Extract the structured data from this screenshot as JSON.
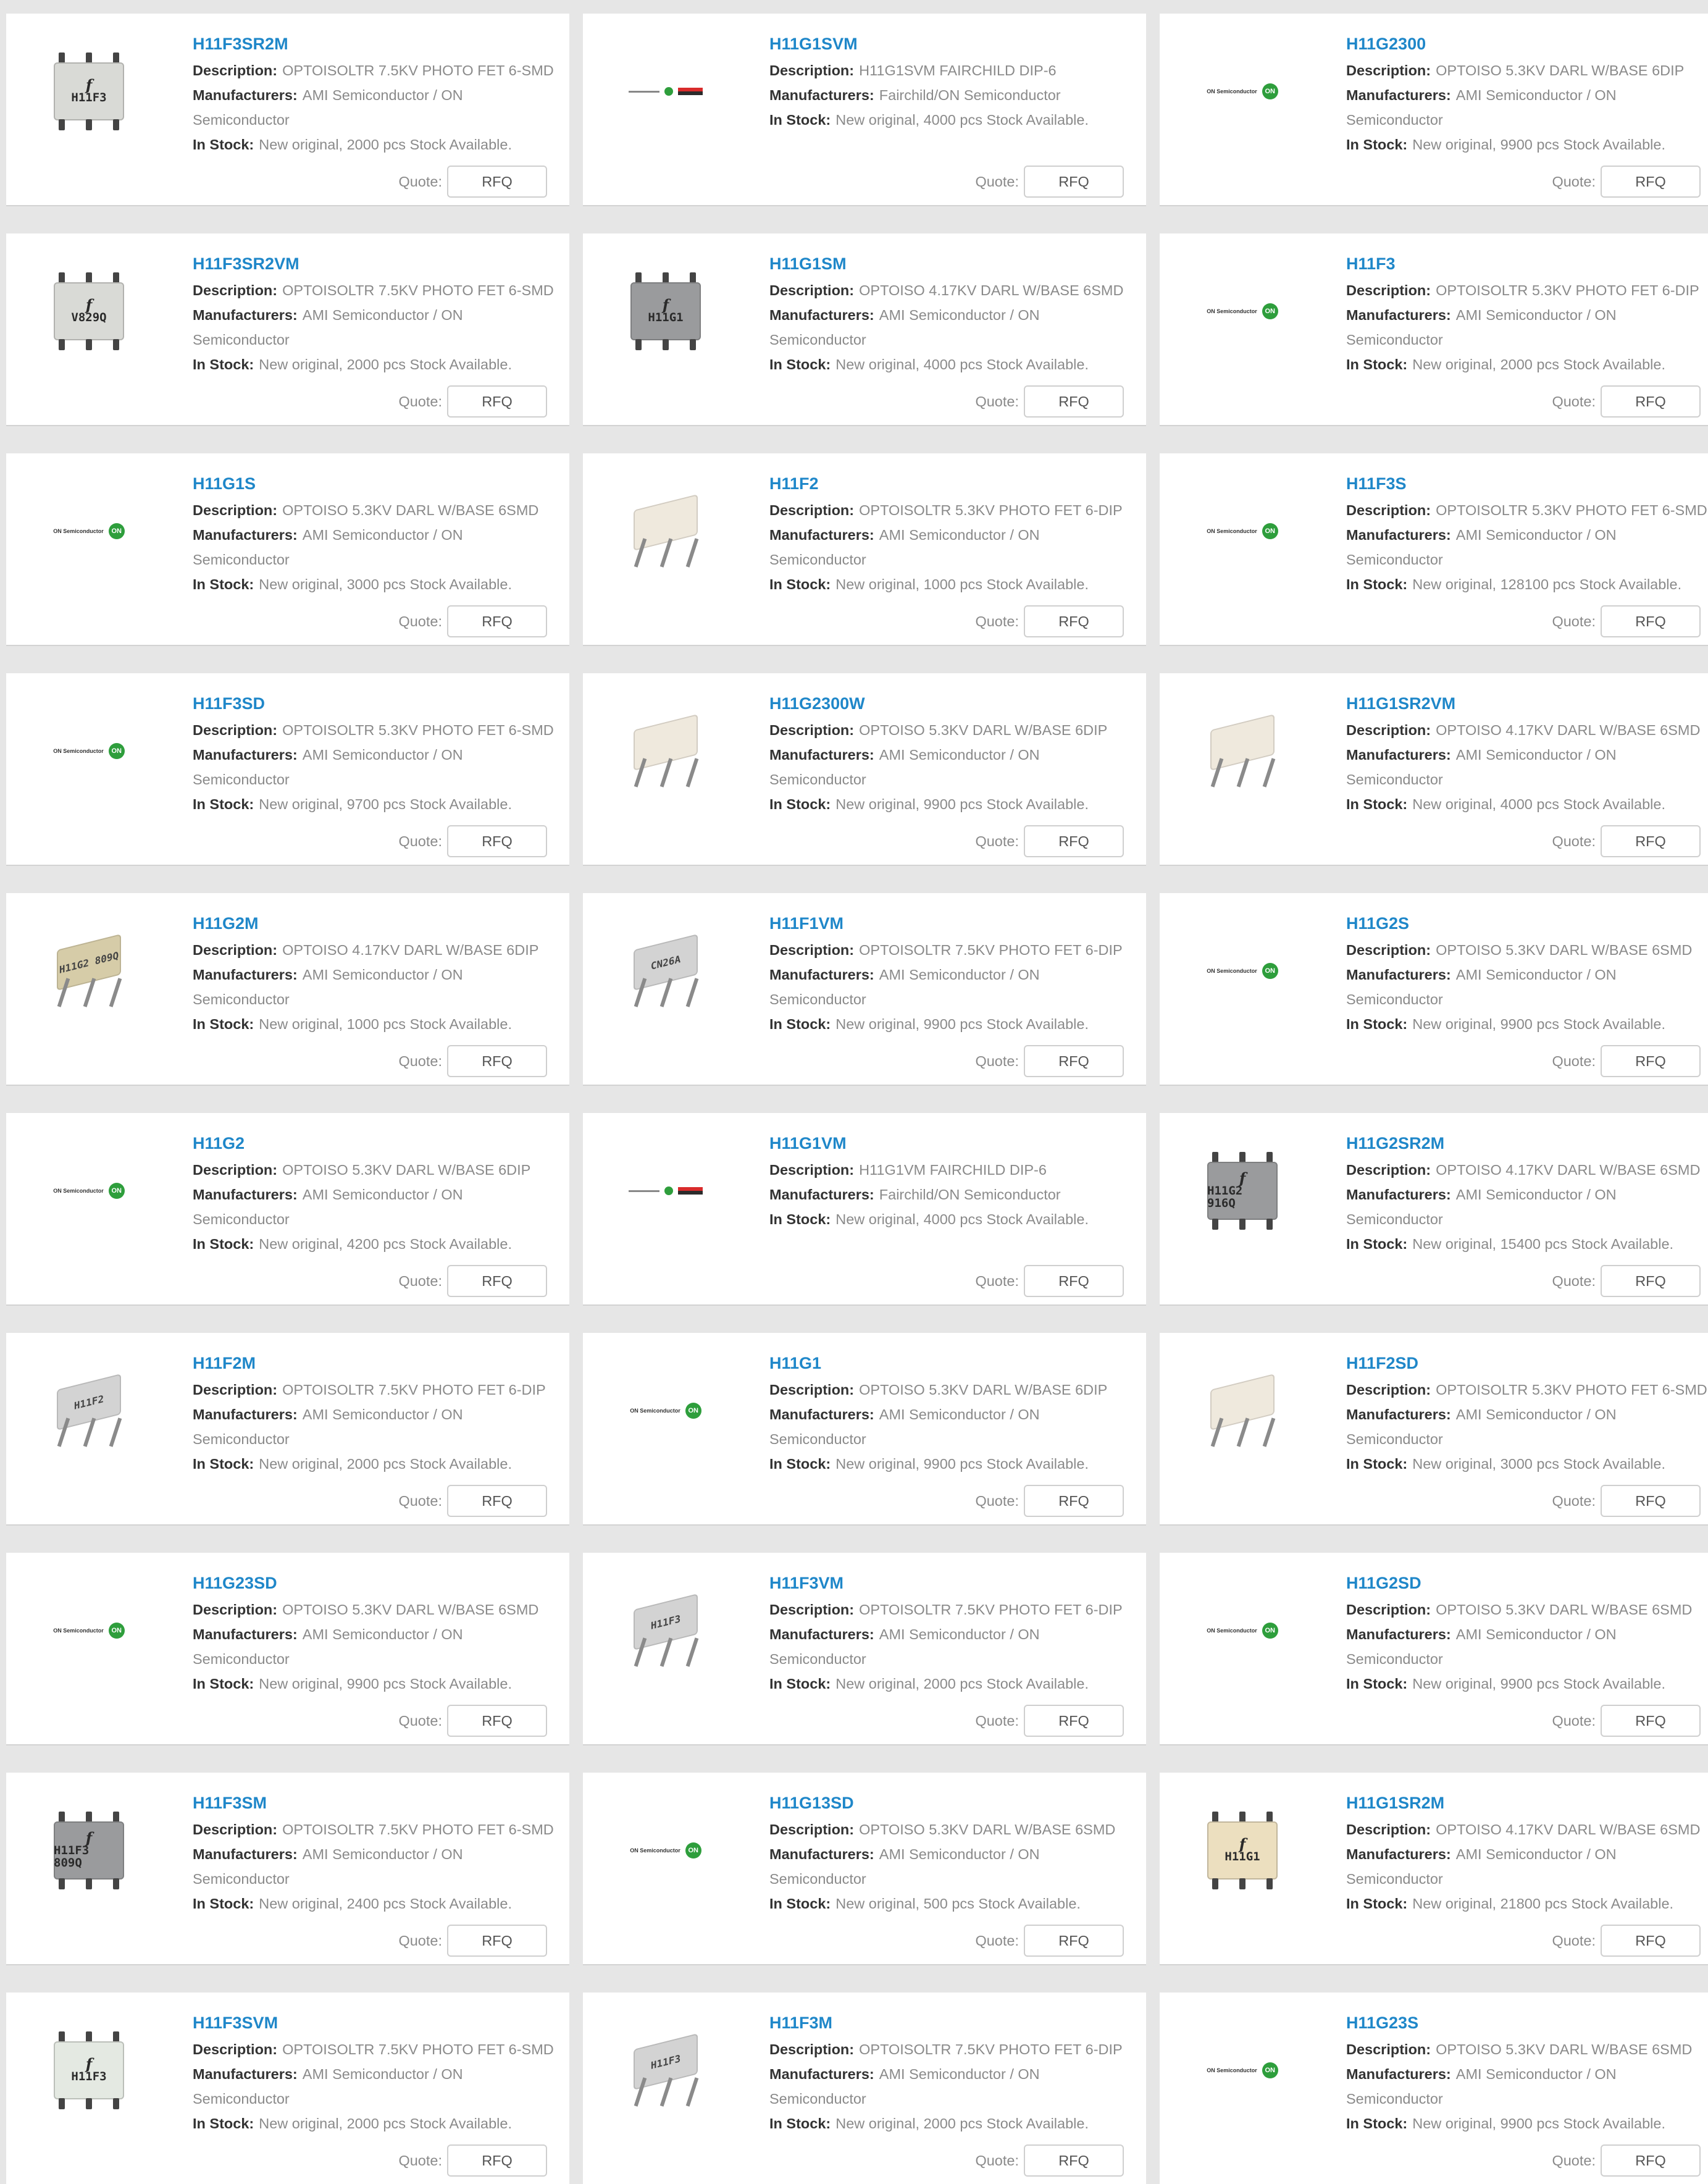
{
  "ui": {
    "quote_label": "Quote:",
    "rfq_label": "RFQ",
    "description_label": "Description:",
    "manufacturers_label": "Manufacturers:",
    "in_stock_label": "In Stock:"
  },
  "products": [
    {
      "name": "H11F3SR2M",
      "description": "OPTOISOLTR 7.5KV PHOTO FET 6-SMD",
      "manufacturer": "AMI Semiconductor / ON Semiconductor",
      "stock": "New original, 2000 pcs Stock Available.",
      "image": "chip",
      "variant": "light",
      "mark1": "f",
      "mark2": "H11F3"
    },
    {
      "name": "H11G1SVM",
      "description": "H11G1SVM FAIRCHILD DIP-6",
      "manufacturer": "Fairchild/ON Semiconductor",
      "stock": "New original, 4000 pcs Stock Available.",
      "image": "logo-fc",
      "variant": "",
      "mark1": "",
      "mark2": ""
    },
    {
      "name": "H11G2300",
      "description": "OPTOISO 5.3KV DARL W/BASE 6DIP",
      "manufacturer": "AMI Semiconductor / ON Semiconductor",
      "stock": "New original, 9900 pcs Stock Available.",
      "image": "logo-on",
      "variant": "",
      "mark1": "",
      "mark2": ""
    },
    {
      "name": "H11F3SR2VM",
      "description": "OPTOISOLTR 7.5KV PHOTO FET 6-SMD",
      "manufacturer": "AMI Semiconductor / ON Semiconductor",
      "stock": "New original, 2000 pcs Stock Available.",
      "image": "chip",
      "variant": "light",
      "mark1": "f",
      "mark2": "V829Q"
    },
    {
      "name": "H11G1SM",
      "description": "OPTOISO 4.17KV DARL W/BASE 6SMD",
      "manufacturer": "AMI Semiconductor / ON Semiconductor",
      "stock": "New original, 4000 pcs Stock Available.",
      "image": "chip",
      "variant": "gray",
      "mark1": "f",
      "mark2": "H11G1"
    },
    {
      "name": "H11F3",
      "description": "OPTOISOLTR 5.3KV PHOTO FET 6-DIP",
      "manufacturer": "AMI Semiconductor / ON Semiconductor",
      "stock": "New original, 2000 pcs Stock Available.",
      "image": "logo-on",
      "variant": "",
      "mark1": "",
      "mark2": ""
    },
    {
      "name": "H11G1S",
      "description": "OPTOISO 5.3KV DARL W/BASE 6SMD",
      "manufacturer": "AMI Semiconductor / ON Semiconductor",
      "stock": "New original, 3000 pcs Stock Available.",
      "image": "logo-on",
      "variant": "",
      "mark1": "",
      "mark2": ""
    },
    {
      "name": "H11F2",
      "description": "OPTOISOLTR 5.3KV PHOTO FET 6-DIP",
      "manufacturer": "AMI Semiconductor / ON Semiconductor",
      "stock": "New original, 1000 pcs Stock Available.",
      "image": "dip",
      "variant": "",
      "mark1": "",
      "mark2": ""
    },
    {
      "name": "H11F3S",
      "description": "OPTOISOLTR 5.3KV PHOTO FET 6-SMD",
      "manufacturer": "AMI Semiconductor / ON Semiconductor",
      "stock": "New original, 128100 pcs Stock Available.",
      "image": "logo-on",
      "variant": "",
      "mark1": "",
      "mark2": ""
    },
    {
      "name": "H11F3SD",
      "description": "OPTOISOLTR 5.3KV PHOTO FET 6-SMD",
      "manufacturer": "AMI Semiconductor / ON Semiconductor",
      "stock": "New original, 9700 pcs Stock Available.",
      "image": "logo-on",
      "variant": "",
      "mark1": "",
      "mark2": ""
    },
    {
      "name": "H11G2300W",
      "description": "OPTOISO 5.3KV DARL W/BASE 6DIP",
      "manufacturer": "AMI Semiconductor / ON Semiconductor",
      "stock": "New original, 9900 pcs Stock Available.",
      "image": "dip",
      "variant": "",
      "mark1": "",
      "mark2": ""
    },
    {
      "name": "H11G1SR2VM",
      "description": "OPTOISO 4.17KV DARL W/BASE 6SMD",
      "manufacturer": "AMI Semiconductor / ON Semiconductor",
      "stock": "New original, 4000 pcs Stock Available.",
      "image": "dip",
      "variant": "",
      "mark1": "",
      "mark2": ""
    },
    {
      "name": "H11G2M",
      "description": "OPTOISO 4.17KV DARL W/BASE 6DIP",
      "manufacturer": "AMI Semiconductor / ON Semiconductor",
      "stock": "New original, 1000 pcs Stock Available.",
      "image": "dip",
      "variant": "tan",
      "mark1": "",
      "mark2": "H11G2 809Q"
    },
    {
      "name": "H11F1VM",
      "description": "OPTOISOLTR 7.5KV PHOTO FET 6-DIP",
      "manufacturer": "AMI Semiconductor / ON Semiconductor",
      "stock": "New original, 9900 pcs Stock Available.",
      "image": "dip",
      "variant": "grey",
      "mark1": "",
      "mark2": "CN26A"
    },
    {
      "name": "H11G2S",
      "description": "OPTOISO 5.3KV DARL W/BASE 6SMD",
      "manufacturer": "AMI Semiconductor / ON Semiconductor",
      "stock": "New original, 9900 pcs Stock Available.",
      "image": "logo-on",
      "variant": "",
      "mark1": "",
      "mark2": ""
    },
    {
      "name": "H11G2",
      "description": "OPTOISO 5.3KV DARL W/BASE 6DIP",
      "manufacturer": "AMI Semiconductor / ON Semiconductor",
      "stock": "New original, 4200 pcs Stock Available.",
      "image": "logo-on",
      "variant": "",
      "mark1": "",
      "mark2": ""
    },
    {
      "name": "H11G1VM",
      "description": "H11G1VM FAIRCHILD DIP-6",
      "manufacturer": "Fairchild/ON Semiconductor",
      "stock": "New original, 4000 pcs Stock Available.",
      "image": "logo-fc",
      "variant": "",
      "mark1": "",
      "mark2": ""
    },
    {
      "name": "H11G2SR2M",
      "description": "OPTOISO 4.17KV DARL W/BASE 6SMD",
      "manufacturer": "AMI Semiconductor / ON Semiconductor",
      "stock": "New original, 15400 pcs Stock Available.",
      "image": "chip",
      "variant": "gray",
      "mark1": "f",
      "mark2": "H11G2 916Q"
    },
    {
      "name": "H11F2M",
      "description": "OPTOISOLTR 7.5KV PHOTO FET 6-DIP",
      "manufacturer": "AMI Semiconductor / ON Semiconductor",
      "stock": "New original, 2000 pcs Stock Available.",
      "image": "dip",
      "variant": "grey",
      "mark1": "",
      "mark2": "H11F2"
    },
    {
      "name": "H11G1",
      "description": "OPTOISO 5.3KV DARL W/BASE 6DIP",
      "manufacturer": "AMI Semiconductor / ON Semiconductor",
      "stock": "New original, 9900 pcs Stock Available.",
      "image": "logo-on",
      "variant": "",
      "mark1": "",
      "mark2": ""
    },
    {
      "name": "H11F2SD",
      "description": "OPTOISOLTR 5.3KV PHOTO FET 6-SMD",
      "manufacturer": "AMI Semiconductor / ON Semiconductor",
      "stock": "New original, 3000 pcs Stock Available.",
      "image": "dip",
      "variant": "",
      "mark1": "",
      "mark2": ""
    },
    {
      "name": "H11G23SD",
      "description": "OPTOISO 5.3KV DARL W/BASE 6SMD",
      "manufacturer": "AMI Semiconductor / ON Semiconductor",
      "stock": "New original, 9900 pcs Stock Available.",
      "image": "logo-on",
      "variant": "",
      "mark1": "",
      "mark2": ""
    },
    {
      "name": "H11F3VM",
      "description": "OPTOISOLTR 7.5KV PHOTO FET 6-DIP",
      "manufacturer": "AMI Semiconductor / ON Semiconductor",
      "stock": "New original, 2000 pcs Stock Available.",
      "image": "dip",
      "variant": "grey",
      "mark1": "",
      "mark2": "H11F3"
    },
    {
      "name": "H11G2SD",
      "description": "OPTOISO 5.3KV DARL W/BASE 6SMD",
      "manufacturer": "AMI Semiconductor / ON Semiconductor",
      "stock": "New original, 9900 pcs Stock Available.",
      "image": "logo-on",
      "variant": "",
      "mark1": "",
      "mark2": ""
    },
    {
      "name": "H11F3SM",
      "description": "OPTOISOLTR 7.5KV PHOTO FET 6-SMD",
      "manufacturer": "AMI Semiconductor / ON Semiconductor",
      "stock": "New original, 2400 pcs Stock Available.",
      "image": "chip",
      "variant": "gray",
      "mark1": "f",
      "mark2": "H11F3 809Q"
    },
    {
      "name": "H11G13SD",
      "description": "OPTOISO 5.3KV DARL W/BASE 6SMD",
      "manufacturer": "AMI Semiconductor / ON Semiconductor",
      "stock": "New original, 500 pcs Stock Available.",
      "image": "logo-on",
      "variant": "",
      "mark1": "",
      "mark2": ""
    },
    {
      "name": "H11G1SR2M",
      "description": "OPTOISO 4.17KV DARL W/BASE 6SMD",
      "manufacturer": "AMI Semiconductor / ON Semiconductor",
      "stock": "New original, 21800 pcs Stock Available.",
      "image": "chip",
      "variant": "cream",
      "mark1": "f",
      "mark2": "H11G1"
    },
    {
      "name": "H11F3SVM",
      "description": "OPTOISOLTR 7.5KV PHOTO FET 6-SMD",
      "manufacturer": "AMI Semiconductor / ON Semiconductor",
      "stock": "New original, 2000 pcs Stock Available.",
      "image": "chip",
      "variant": "pale",
      "mark1": "f",
      "mark2": "H11F3"
    },
    {
      "name": "H11F3M",
      "description": "OPTOISOLTR 7.5KV PHOTO FET 6-DIP",
      "manufacturer": "AMI Semiconductor / ON Semiconductor",
      "stock": "New original, 2000 pcs Stock Available.",
      "image": "dip",
      "variant": "grey",
      "mark1": "",
      "mark2": "H11F3"
    },
    {
      "name": "H11G23S",
      "description": "OPTOISO 5.3KV DARL W/BASE 6SMD",
      "manufacturer": "AMI Semiconductor / ON Semiconductor",
      "stock": "New original, 9900 pcs Stock Available.",
      "image": "logo-on",
      "variant": "",
      "mark1": "",
      "mark2": ""
    }
  ]
}
